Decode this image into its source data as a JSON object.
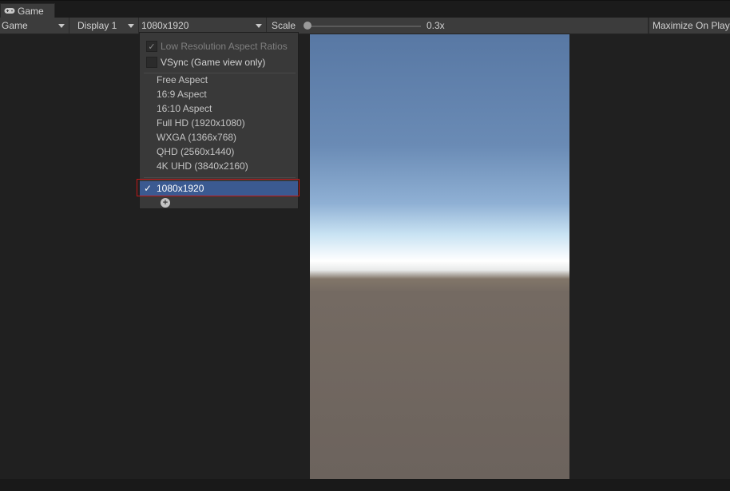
{
  "tab": {
    "icon": "gamepad-icon",
    "label": "Game"
  },
  "toolbar": {
    "mode": "Game",
    "display": "Display 1",
    "resolution": "1080x1920",
    "scale_label": "Scale",
    "scale_value": "0.3x",
    "maximize": "Maximize On Play"
  },
  "menu": {
    "low_res": "Low Resolution Aspect Ratios",
    "vsync": "VSync (Game view only)",
    "items": [
      "Free Aspect",
      "16:9 Aspect",
      "16:10 Aspect",
      "Full HD (1920x1080)",
      "WXGA (1366x768)",
      "QHD (2560x1440)",
      "4K UHD (3840x2160)"
    ],
    "selected": "1080x1920",
    "check_mark": "✓",
    "add_icon": "plus-circle-icon"
  },
  "colors": {
    "highlight": "#3b5a91",
    "outline": "#c01818"
  }
}
